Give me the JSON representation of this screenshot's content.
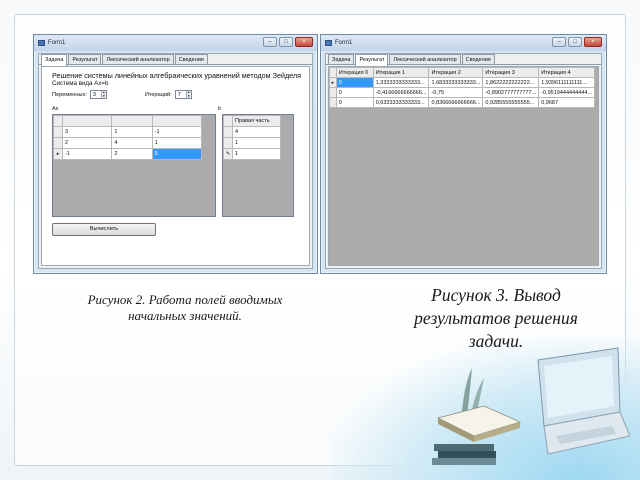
{
  "window_left": {
    "title": "Form1",
    "tabs": [
      "Задача",
      "Результат",
      "Лексический анализатор",
      "Сведения"
    ],
    "active_tab": 0,
    "task_title": "Решение системы линейных алгебраических уравнений методом Зейделя",
    "task_subtitle": "Система вида Ax=b",
    "vars_label": "Переменных:",
    "vars_value": "3",
    "iter_label": "Итераций:",
    "iter_value": "7",
    "matrix_label": "Ax",
    "vector_label": "b",
    "matrix_rows": [
      [
        "3",
        "1",
        "-1"
      ],
      [
        "2",
        "4",
        "1"
      ],
      [
        "-1",
        "2",
        "5"
      ]
    ],
    "selected_row_marker": "▸",
    "vector_header": "Правая часть",
    "vector_rows": [
      "4",
      "1",
      "1"
    ],
    "vector_row_marker": "✎",
    "calc_button": "Вычислить"
  },
  "window_right": {
    "title": "Form1",
    "tabs": [
      "Задача",
      "Результат",
      "Лексический анализатор",
      "Сведения"
    ],
    "active_tab": 1,
    "headers": [
      "Итерация 0",
      "Итерация 1",
      "Итерация 2",
      "Итерация 3",
      "Итерация 4"
    ],
    "rows": [
      [
        "0",
        "1,3333333333333...",
        "1,6833333333333...",
        "1,8622222222222...",
        "1,9396111111111..."
      ],
      [
        "0",
        "-0,4166666666666...",
        "-0,75",
        "-0,8902777777777...",
        "-0,9519444444444..."
      ],
      [
        "0",
        "0,6333333333333...",
        "0,8366666666666...",
        "0,9285555555555...",
        "0,9687"
      ]
    ],
    "selected_row_marker": "▸"
  },
  "captions": {
    "fig2_line1": "Рисунок 2.  Работа полей вводимых",
    "fig2_line2": "начальных значений.",
    "fig3_line1": "Рисунок 3. Вывод",
    "fig3_line2": "результатов решения",
    "fig3_line3": "задачи."
  },
  "colors": {
    "selection": "#3399ff",
    "grid_background": "#ababab",
    "window_frame": "#d7e4f2"
  }
}
